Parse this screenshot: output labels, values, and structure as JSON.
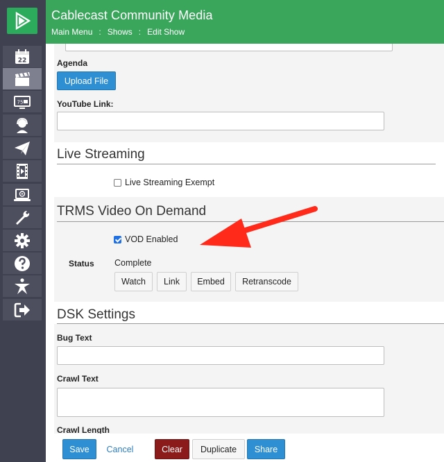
{
  "app": {
    "title": "Cablecast Community Media",
    "breadcrumb": [
      "Main Menu",
      "Shows",
      "Edit Show"
    ],
    "breadcrumb_separator": ":"
  },
  "sidebar": {
    "items": [
      {
        "icon": "calendar-icon",
        "text": "22"
      },
      {
        "icon": "clapperboard-icon",
        "active": true
      },
      {
        "icon": "tv-monitor-icon",
        "text": "75"
      },
      {
        "icon": "person-headset-icon"
      },
      {
        "icon": "paper-plane-icon"
      },
      {
        "icon": "film-strip-icon"
      },
      {
        "icon": "laptop-play-icon"
      },
      {
        "icon": "wrench-icon"
      },
      {
        "icon": "gear-icon"
      },
      {
        "icon": "question-icon"
      },
      {
        "icon": "star-figure-icon"
      },
      {
        "icon": "sign-out-icon"
      }
    ]
  },
  "form": {
    "agenda_label": "Agenda",
    "upload_button": "Upload File",
    "youtube_label": "YouTube Link:",
    "youtube_value": "",
    "live_streaming": {
      "title": "Live Streaming",
      "exempt_label": "Live Streaming Exempt",
      "exempt_checked": false
    },
    "vod": {
      "title": "TRMS Video On Demand",
      "enabled_label": "VOD Enabled",
      "enabled_checked": true,
      "status_label": "Status",
      "status_value": "Complete",
      "buttons": [
        "Watch",
        "Link",
        "Embed",
        "Retranscode"
      ]
    },
    "dsk": {
      "title": "DSK Settings",
      "bug_text_label": "Bug Text",
      "bug_text_value": "",
      "crawl_text_label": "Crawl Text",
      "crawl_text_value": "",
      "crawl_length_label": "Crawl Length"
    }
  },
  "footer": {
    "save": "Save",
    "cancel": "Cancel",
    "clear": "Clear",
    "duplicate": "Duplicate",
    "share": "Share"
  },
  "colors": {
    "header": "#3aa65c",
    "sidebar": "#3f4050",
    "primary_button": "#2e8fd2",
    "clear_button": "#8b1a1a",
    "annotation_arrow": "#ff2a1a"
  }
}
